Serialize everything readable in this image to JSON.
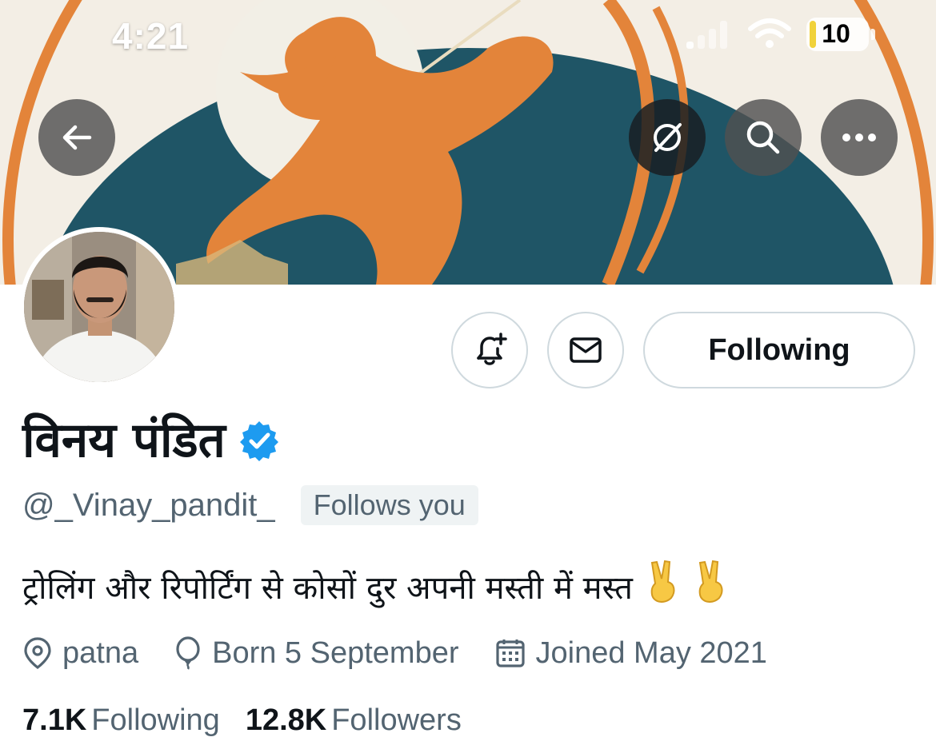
{
  "status_bar": {
    "time": "4:21",
    "battery_level": "10"
  },
  "header_buttons": {
    "back_icon": "arrow-left-icon",
    "grok_icon": "slashed-circle-icon",
    "search_icon": "search-icon",
    "more_icon": "more-horizontal-icon"
  },
  "profile": {
    "display_name": "विनय पंडित",
    "verified": true,
    "handle": "@_Vinay_pandit_",
    "follows_you": "Follows you",
    "bio": "ट्रोलिंग और रिपोर्टिंग से कोसों दुर अपनी मस्ती में मस्त",
    "bio_emoji": "✌️ ✌️",
    "location": "patna",
    "birthday": "Born 5 September",
    "joined": "Joined May 2021",
    "following_count": "7.1K",
    "following_label": "Following",
    "followers_count": "12.8K",
    "followers_label": "Followers"
  },
  "actions": {
    "notify_icon": "bell-plus-icon",
    "message_icon": "envelope-icon",
    "following_button": "Following"
  },
  "colors": {
    "verified_blue": "#1d9bf0",
    "secondary_text": "#536471",
    "primary_text": "#0f1419",
    "border": "#cfd9de",
    "banner_teal": "#1f5566",
    "banner_orange": "#e3843a"
  }
}
